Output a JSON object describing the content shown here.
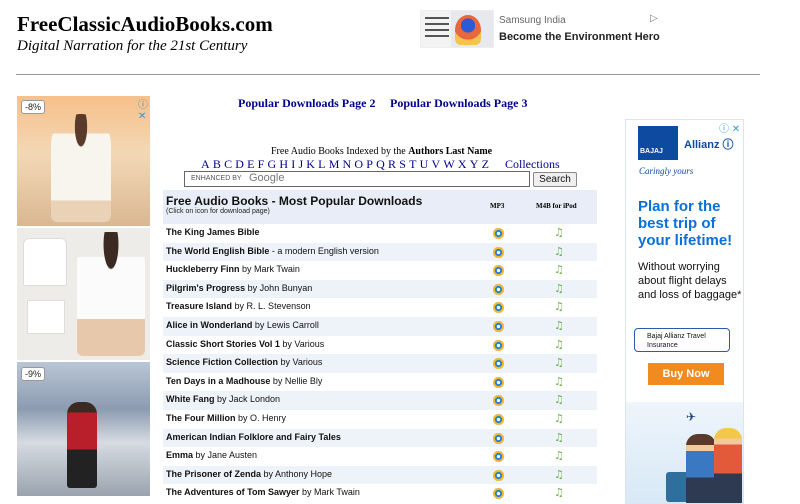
{
  "site": {
    "title": "FreeClassicAudioBooks.com",
    "tagline": "Digital Narration for the 21st Century"
  },
  "top_ad": {
    "brand": "Samsung India",
    "headline": "Become the Environment Hero",
    "play_icon": "▷"
  },
  "left_ad": {
    "discount1": "-8%",
    "discount2": "-9%",
    "adchoices_icon": "ⓘ ✕"
  },
  "popular_links": {
    "page2": "Popular Downloads Page 2",
    "page3": "Popular Downloads Page 3"
  },
  "index": {
    "prefix": "Free Audio Books Indexed by the",
    "bold": "Authors Last Name",
    "letters": [
      "A",
      "B",
      "C",
      "D",
      "E",
      "F",
      "G",
      "H",
      "I",
      "J",
      "K",
      "L",
      "M",
      "N",
      "O",
      "P",
      "Q",
      "R",
      "S",
      "T",
      "U",
      "V",
      "W",
      "X",
      "Y",
      "Z"
    ],
    "collections": "Collections"
  },
  "search": {
    "enhanced_by": "ENHANCED BY",
    "google": "Google",
    "button": "Search"
  },
  "list": {
    "title": "Free Audio Books - Most Popular Downloads",
    "subtitle": "(Click on icon for download page)",
    "col_mp3": "MP3",
    "col_m4b": "M4B for iPod",
    "rows": [
      {
        "title": "The King James Bible",
        "by": ""
      },
      {
        "title": "The World English Bible",
        "by": " - a modern English version"
      },
      {
        "title": "Huckleberry Finn",
        "by": " by Mark Twain"
      },
      {
        "title": "Pilgrim's Progress",
        "by": " by John Bunyan"
      },
      {
        "title": "Treasure Island",
        "by": "  by  R. L. Stevenson"
      },
      {
        "title": "Alice in Wonderland",
        "by": " by Lewis Carroll"
      },
      {
        "title": "Classic Short Stories Vol 1",
        "by": " by Various"
      },
      {
        "title": "Science Fiction Collection",
        "by": " by Various"
      },
      {
        "title": "Ten Days in a Madhouse",
        "by": " by Nellie Bly"
      },
      {
        "title": "White Fang",
        "by": " by Jack London"
      },
      {
        "title": "The Four Million",
        "by": " by O. Henry"
      },
      {
        "title": "American Indian Folklore and Fairy Tales",
        "by": ""
      },
      {
        "title": "Emma",
        "by": " by Jane Austen"
      },
      {
        "title": "The Prisoner of Zenda",
        "by": " by Anthony Hope"
      },
      {
        "title": "The Adventures of Tom Sawyer",
        "by": " by Mark Twain"
      }
    ]
  },
  "right_ad": {
    "logo": "BAJAJ",
    "allianz": "Allianz ⓘ",
    "caring": "Caringly yours",
    "headline": "Plan for the best trip of your lifetime!",
    "body": "Without worrying about flight delays and loss of baggage*",
    "badge": "Bajaj Allianz Travel Insurance",
    "buy": "Buy Now",
    "adchoices_icon": "ⓘ ✕"
  }
}
